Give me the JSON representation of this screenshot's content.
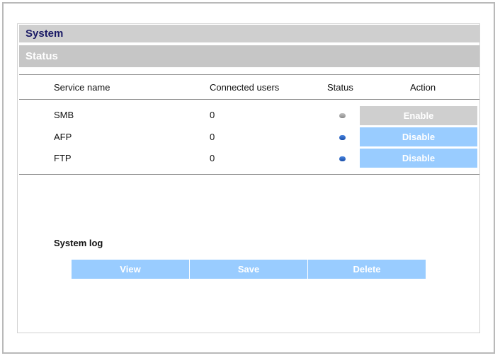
{
  "header": {
    "title": "System"
  },
  "status_section": {
    "title": "Status",
    "columns": {
      "service": "Service name",
      "users": "Connected users",
      "status": "Status",
      "action": "Action"
    },
    "rows": [
      {
        "name": "SMB",
        "users": "0",
        "status": "off",
        "action": "Enable"
      },
      {
        "name": "AFP",
        "users": "0",
        "status": "on",
        "action": "Disable"
      },
      {
        "name": "FTP",
        "users": "0",
        "status": "on",
        "action": "Disable"
      }
    ]
  },
  "system_log": {
    "title": "System log",
    "view_label": "View",
    "save_label": "Save",
    "delete_label": "Delete"
  },
  "colors": {
    "button_active": "#99ccff",
    "button_inactive": "#cfcfcf",
    "status_on": "#1b4fa8",
    "status_off": "#9a9a9a",
    "header_text": "#1a1a66"
  }
}
